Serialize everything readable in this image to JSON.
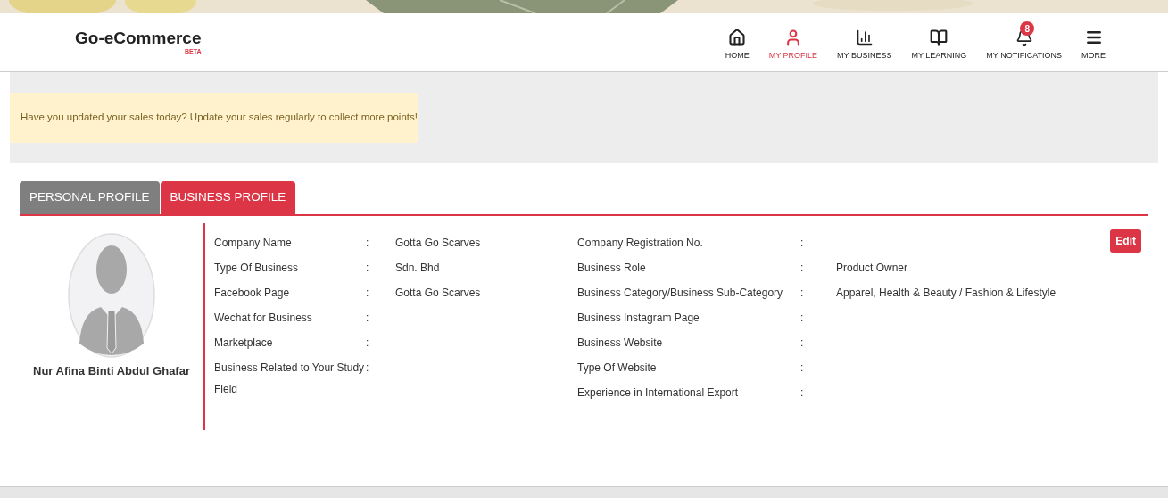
{
  "logo": {
    "name": "Go-eCommerce",
    "badge": "BETA"
  },
  "nav": [
    {
      "kind": "home",
      "label": "HOME",
      "selected": false
    },
    {
      "kind": "profile",
      "label": "MY PROFILE",
      "selected": true
    },
    {
      "kind": "business",
      "label": "MY BUSINESS",
      "selected": false
    },
    {
      "kind": "learning",
      "label": "MY LEARNING",
      "selected": false
    },
    {
      "kind": "notifications",
      "label": "MY NOTIFICATIONS",
      "selected": false,
      "count": "8"
    },
    {
      "kind": "more",
      "label": "MORE",
      "selected": false
    }
  ],
  "alert": "Have you updated your sales today? Update your sales regularly to collect more points!",
  "tabs": [
    {
      "label": "PERSONAL PROFILE",
      "selected": false
    },
    {
      "label": "BUSINESS PROFILE",
      "selected": true
    }
  ],
  "profile": {
    "name": "Nur Afina Binti Abdul Ghafar"
  },
  "edit_button": "Edit",
  "fields_left": [
    {
      "label": "Company Name",
      "separator": ":",
      "value": "Gotta Go Scarves"
    },
    {
      "label": "Type Of Business",
      "separator": ":",
      "value": "Sdn. Bhd"
    },
    {
      "label": "Facebook Page",
      "separator": ":",
      "value": "Gotta Go Scarves"
    },
    {
      "label": "Wechat for Business",
      "separator": ":"
    },
    {
      "label": "Marketplace",
      "separator": ":"
    },
    {
      "label": "Business Related to Your Study Field",
      "separator": ":"
    }
  ],
  "fields_right": [
    {
      "label": "Company Registration No.",
      "separator": ":"
    },
    {
      "label": "Business Role",
      "separator": ":",
      "value": "Product Owner"
    },
    {
      "label": "Business Category/Business Sub-Category",
      "separator": ":",
      "value": "Apparel, Health & Beauty / Fashion & Lifestyle"
    },
    {
      "label": "Business Instagram Page",
      "separator": ":"
    },
    {
      "label": "Business Website",
      "separator": ":"
    },
    {
      "label": "Type Of Website",
      "separator": ":"
    },
    {
      "label": "Experience in International Export",
      "separator": ":"
    }
  ]
}
